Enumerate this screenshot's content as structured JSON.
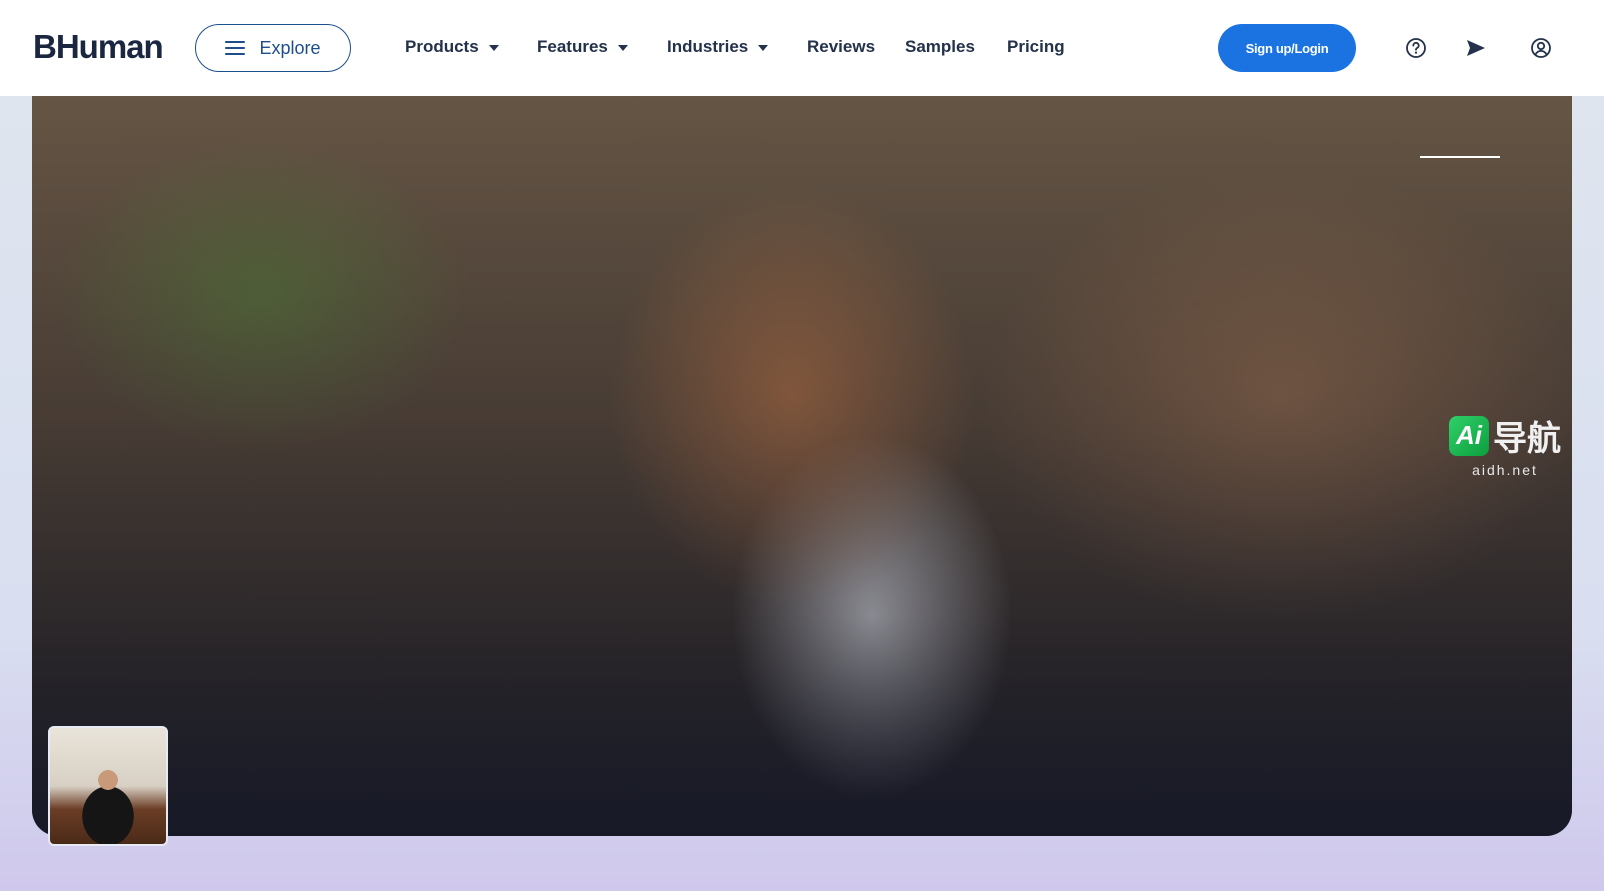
{
  "header": {
    "logo": "BHuman",
    "explore_label": "Explore",
    "nav": [
      {
        "label": "Products",
        "has_dropdown": true
      },
      {
        "label": "Features",
        "has_dropdown": true
      },
      {
        "label": "Industries",
        "has_dropdown": true
      },
      {
        "label": "Reviews",
        "has_dropdown": false
      },
      {
        "label": "Samples",
        "has_dropdown": false
      },
      {
        "label": "Pricing",
        "has_dropdown": false
      }
    ],
    "signup_label": "Sign up/Login",
    "icons": [
      "help-circle-icon",
      "send-icon",
      "user-circle-icon"
    ]
  },
  "watermark": {
    "badge": "Ai",
    "text": "导航",
    "sub": "aidh.net"
  },
  "colors": {
    "accent": "#1a73e0",
    "nav_text": "#23324a",
    "explore_border": "#1d4f8f"
  }
}
